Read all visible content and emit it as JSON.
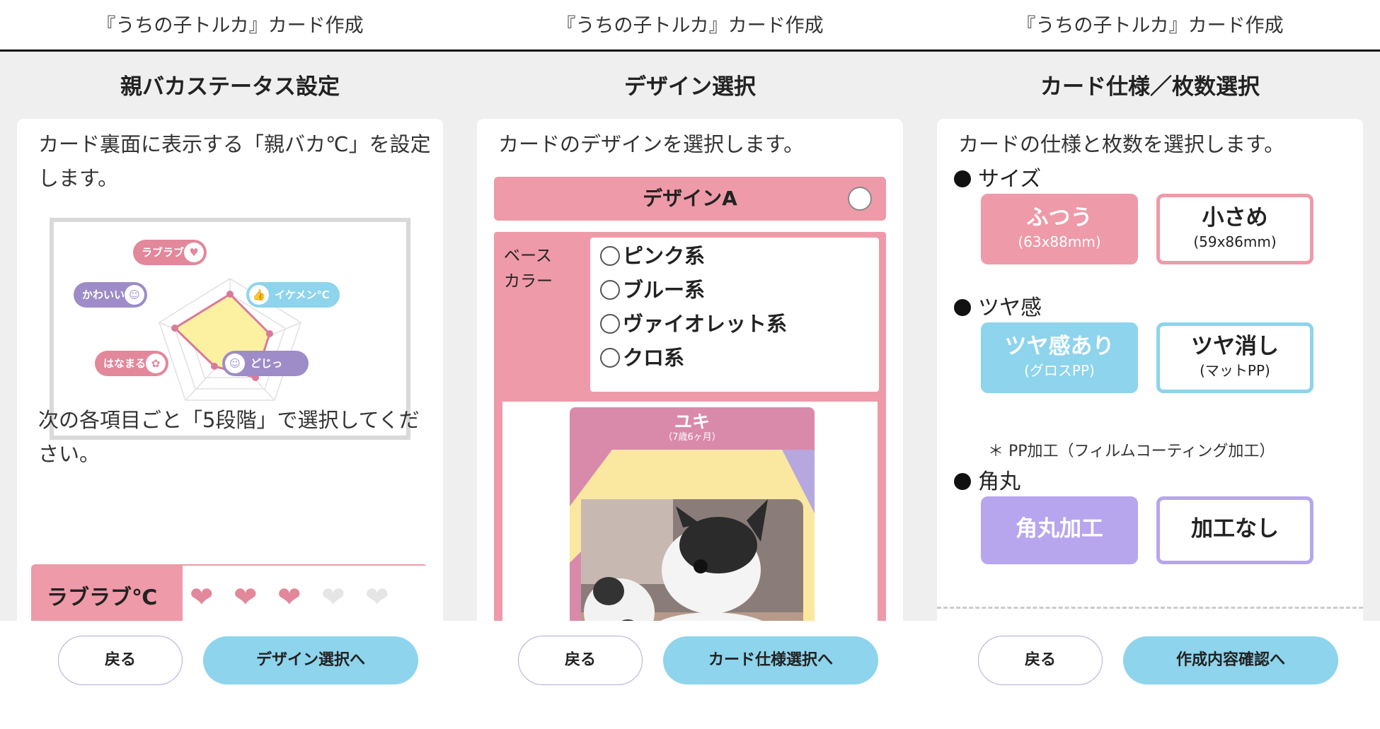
{
  "app_title": "『うちの子トルカ』カード作成",
  "panels": [
    {
      "title": "親バカステータス設定",
      "intro": "カード裏面に表示する「親バカ℃」を設定します。",
      "radar_labels": [
        "ラブラブ℃",
        "イケメン℃",
        "どじっこ℃",
        "はなまる℃",
        "かわいい℃"
      ],
      "instruction": "次の各項目ごと「5段階」で選択してください。",
      "rating": {
        "label": "ラブラブ℃",
        "filled": 3,
        "total": 5
      },
      "back": "戻る",
      "next": "デザイン選択へ"
    },
    {
      "title": "デザイン選択",
      "intro": "カードのデザインを選択します。",
      "design_name": "デザインA",
      "base_label": "ベース\nカラー",
      "colors": [
        "ピンク系",
        "ブルー系",
        "ヴァイオレット系",
        "クロ系"
      ],
      "preview_name": "ユキ",
      "preview_age": "（7歳6ヶ月）",
      "back": "戻る",
      "next": "カード仕様選択へ"
    },
    {
      "title": "カード仕様／枚数選択",
      "intro": "カードの仕様と枚数を選択します。",
      "size_label": "サイズ",
      "size_options": [
        {
          "title": "ふつう",
          "sub": "(63x88mm)"
        },
        {
          "title": "小さめ",
          "sub": "(59x86mm)"
        }
      ],
      "gloss_label": "ツヤ感",
      "gloss_options": [
        {
          "title": "ツヤ感あり",
          "sub": "(グロスPP)"
        },
        {
          "title": "ツヤ消し",
          "sub": "(マットPP)"
        }
      ],
      "note": "＊ PP加工（フィルムコーティング加工）",
      "corner_label": "角丸",
      "corner_options": [
        "角丸加工",
        "加工なし"
      ],
      "back": "戻る",
      "next": "作成内容確認へ"
    }
  ],
  "colors": {
    "pink": "#ee9aa8",
    "blue": "#8dd4ec",
    "violet": "#b7a6ee",
    "radar_fill": "#fcf1a0"
  }
}
